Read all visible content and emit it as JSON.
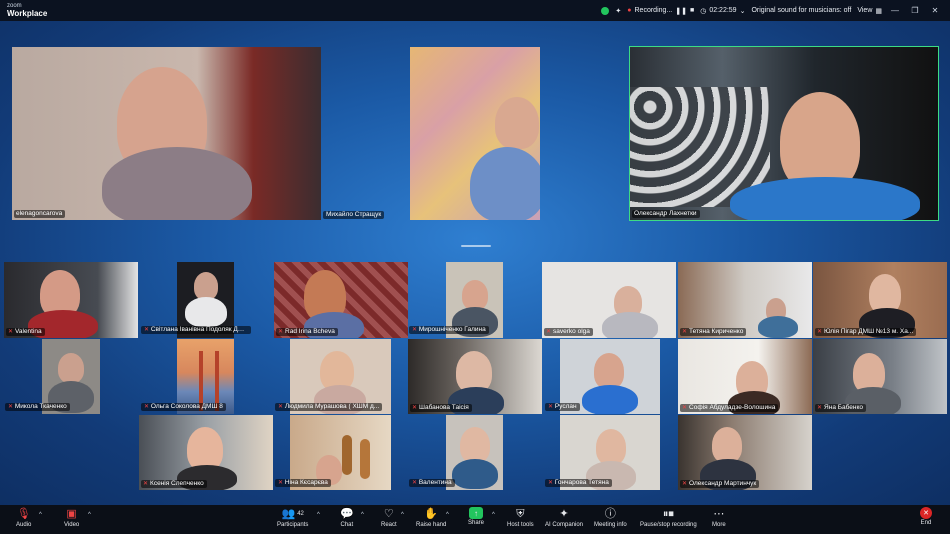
{
  "app": {
    "logo_line1": "zoom",
    "logo_line2": "Workplace"
  },
  "titlebar": {
    "recording_label": "Recording...",
    "timer": "02:22:59",
    "original_sound": "Original sound for musicians: off",
    "view_label": "View"
  },
  "colors": {
    "active_speaker": "#3ddc84",
    "end": "#dc2626",
    "share": "#22c55e",
    "mic_off": "#ef4444"
  },
  "participants_top": [
    {
      "name": "elenagoncarova"
    },
    {
      "name": "Михайло Стращук"
    },
    {
      "name": "Олександр Лахнетки"
    }
  ],
  "participants_grid": [
    {
      "name": "Valentina"
    },
    {
      "name": "Світлана Іванівна Подоляк ДМ..."
    },
    {
      "name": "Rad Irina Bcheva"
    },
    {
      "name": "Мирошніченко Галина"
    },
    {
      "name": "saverko olga"
    },
    {
      "name": "Тетяна Кириченко"
    },
    {
      "name": "Юлія Пігар ДМШ №13 м. Ха..."
    },
    {
      "name": "Микола Ткаченко"
    },
    {
      "name": "Ольга Соколова ДМШ 8"
    },
    {
      "name": "Людмила Мурашова ( ХШМ д..."
    },
    {
      "name": "Шабанова Таісія"
    },
    {
      "name": "Руслан"
    },
    {
      "name": "Софія Абдуладзе-Волошина"
    },
    {
      "name": "Яна Бабенко"
    },
    {
      "name": "Ксенія Слепченко"
    },
    {
      "name": "Ніна Кєсарєва"
    },
    {
      "name": "Валентина"
    },
    {
      "name": "Гончарова Тетяна"
    },
    {
      "name": "Олександр Мартинчук"
    }
  ],
  "toolbar": {
    "audio": "Audio",
    "video": "Video",
    "participants": "Participants",
    "participants_count": "42",
    "chat": "Chat",
    "react": "React",
    "raise_hand": "Raise hand",
    "share": "Share",
    "host_tools": "Host tools",
    "ai_companion": "AI Companion",
    "meeting_info": "Meeting info",
    "pause_recording": "Pause/stop recording",
    "more": "More",
    "end": "End"
  },
  "icons": [
    "mic-off-icon",
    "video-off-icon",
    "participants-icon",
    "chat-icon",
    "react-icon",
    "hand-icon",
    "share-icon",
    "shield-icon",
    "sparkle-icon",
    "info-icon",
    "pause-icon",
    "more-icon",
    "end-icon"
  ]
}
